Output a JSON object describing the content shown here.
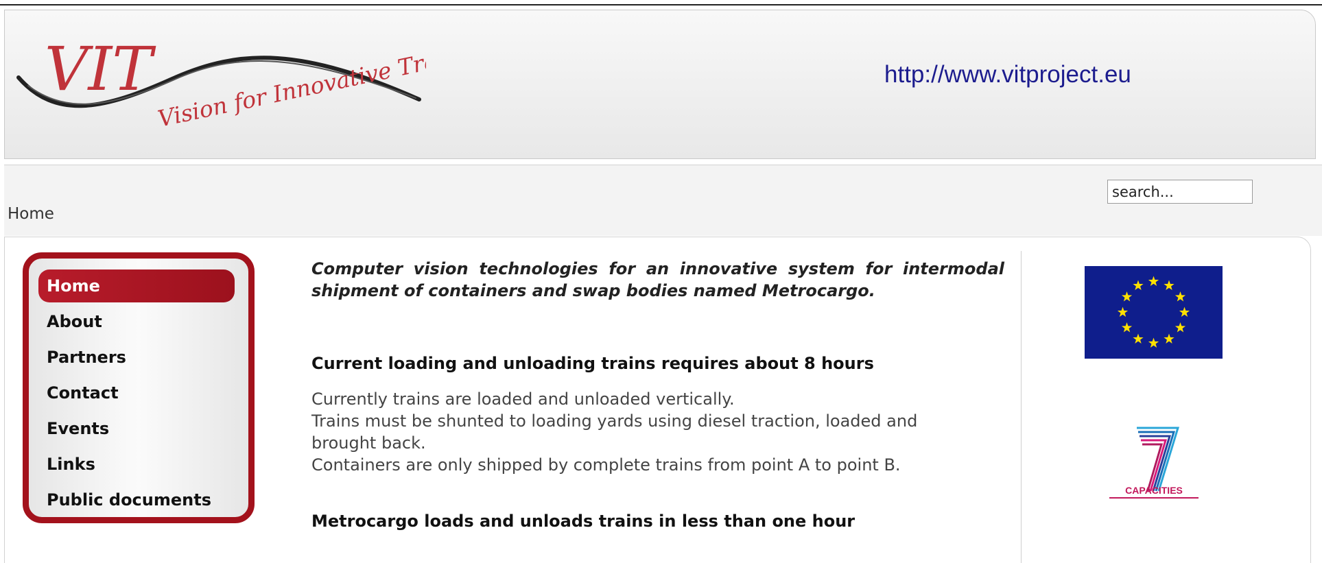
{
  "header": {
    "logo": {
      "brand": "VIT",
      "tagline": "Vision for Innovative Transport",
      "brand_color": "#c0333a"
    },
    "site_url": "http://www.vitproject.eu"
  },
  "breadcrumb": {
    "current": "Home"
  },
  "search": {
    "placeholder": "search..."
  },
  "menu": {
    "accent": "#a3121c",
    "items": [
      {
        "label": "Home",
        "active": true
      },
      {
        "label": "About",
        "active": false
      },
      {
        "label": "Partners",
        "active": false
      },
      {
        "label": "Contact",
        "active": false
      },
      {
        "label": "Events",
        "active": false
      },
      {
        "label": "Links",
        "active": false
      },
      {
        "label": "Public documents",
        "active": false
      }
    ]
  },
  "main": {
    "intro": "Computer vision technologies for an innovative system for intermodal shipment of containers and swap bodies named Metrocargo.",
    "section1": {
      "heading": "Current loading and unloading trains requires about 8 hours",
      "lines": [
        "Currently trains are loaded and unloaded vertically.",
        "Trains must be shunted to loading yards using diesel traction, loaded and",
        "brought back.",
        "Containers are only shipped by complete trains from point A to point B."
      ]
    },
    "section2": {
      "heading": "Metrocargo loads and unloads trains in less than one hour"
    }
  },
  "sidebar_right": {
    "eu_flag": {
      "field_color": "#0f1e8c",
      "star_color": "#ffe000",
      "stars": 12
    },
    "fp7_logo": {
      "text": "CAPACITIES"
    }
  }
}
